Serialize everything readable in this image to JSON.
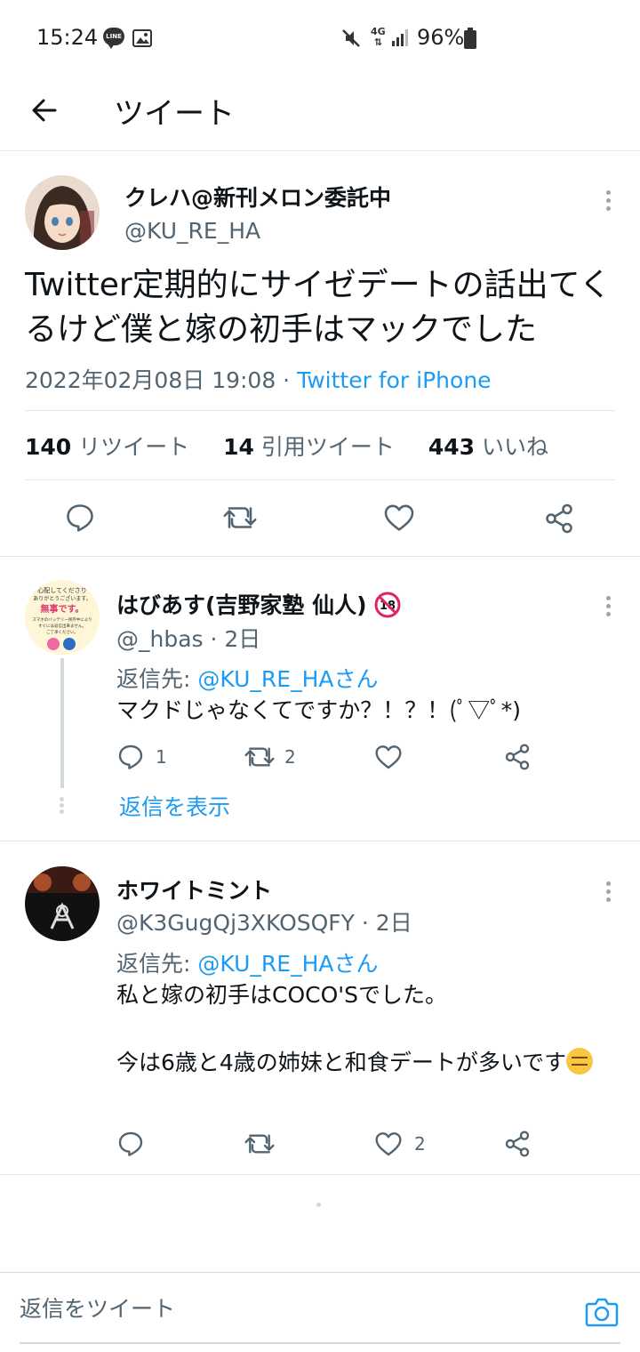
{
  "status_bar": {
    "time": "15:24",
    "line_badge": "LINE",
    "network": "4G",
    "battery": "96%",
    "icons": [
      "line-icon",
      "image-icon",
      "mute-icon",
      "signal-icon",
      "battery-icon"
    ]
  },
  "header": {
    "title": "ツイート"
  },
  "tweet": {
    "author_name": "クレハ@新刊メロン委託中",
    "handle": "@KU_RE_HA",
    "text": "Twitter定期的にサイゼデートの話出てくるけど僕と嫁の初手はマックでした",
    "datetime": "2022年02月08日 19:08 · ",
    "source": "Twitter for iPhone",
    "stats": {
      "retweets": "140",
      "retweets_label": "リツイート",
      "quotes": "14",
      "quotes_label": "引用ツイート",
      "likes": "443",
      "likes_label": "いいね"
    }
  },
  "replies": [
    {
      "name": "はびあす(吉野家塾 仙人)",
      "badge": "18",
      "handle": "@_hbas · 2日",
      "reply_to_prefix": "返信先: ",
      "reply_to": "@KU_RE_HAさん",
      "text": "マクドじゃなくてですか？！？！(ﾟ▽ﾟ*)",
      "avatar_text": [
        "心配してくださり",
        "ありがとうございます。",
        "無事です。",
        "スマホのバッテリー残存中により",
        "すぐには返信出来ません。",
        "ご了承ください。"
      ],
      "counts": {
        "replies": "1",
        "retweets": "2",
        "likes": ""
      },
      "show_replies": "返信を表示"
    },
    {
      "name": "ホワイトミント",
      "handle": "@K3GugQj3XKOSQFY · 2日",
      "reply_to_prefix": "返信先: ",
      "reply_to": "@KU_RE_HAさん",
      "text_line1": "私と嫁の初手はCOCO'Sでした。",
      "text_line2": "今は6歳と4歳の姉妹と和食デートが多いです",
      "counts": {
        "replies": "",
        "retweets": "",
        "likes": "2"
      }
    }
  ],
  "compose": {
    "placeholder": "返信をツイート"
  },
  "colors": {
    "accent": "#1d9bf0",
    "text": "#0f1419",
    "secondary": "#536471",
    "divider": "#e2e6e9"
  }
}
